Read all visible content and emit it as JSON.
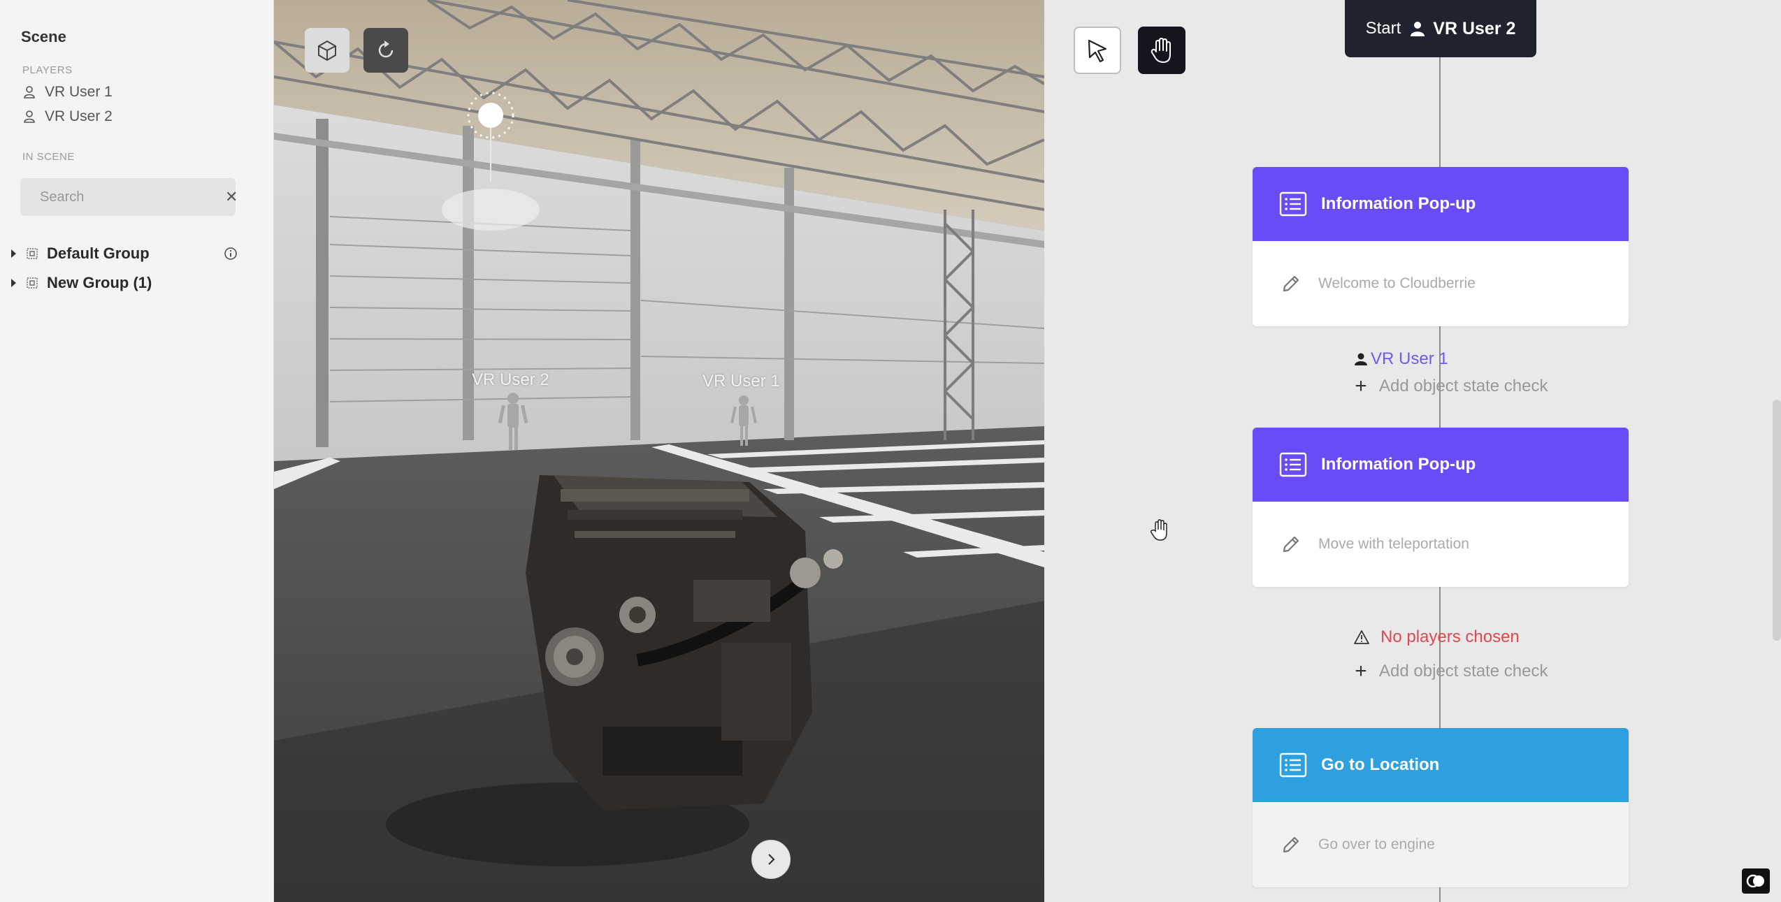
{
  "sidebar": {
    "title": "Scene",
    "players_label": "PLAYERS",
    "players": [
      "VR User 1",
      "VR User 2"
    ],
    "in_scene_label": "IN SCENE",
    "search": {
      "placeholder": "Search",
      "value": ""
    },
    "groups": [
      "Default Group",
      "New Group (1)"
    ]
  },
  "viewport": {
    "avatars": [
      "VR User 2",
      "VR User 1"
    ]
  },
  "flow": {
    "start": {
      "label": "Start",
      "user": "VR User 2"
    },
    "nodes": [
      {
        "title": "Information Pop-up",
        "body": "Welcome to Cloudberrie",
        "color": "#6a4cf6"
      },
      {
        "title": "Information Pop-up",
        "body": "Move with teleportation",
        "color": "#6a4cf6"
      },
      {
        "title": "Go to Location",
        "body": "Go over to engine",
        "color": "#2fa0df"
      }
    ],
    "link1": {
      "user": "VR User 1",
      "add_check": "Add object state check"
    },
    "link2": {
      "warning": "No players chosen",
      "add_check": "Add object state check"
    }
  },
  "colors": {
    "popup_header": "#6a4cf6",
    "location_header": "#2fa0df",
    "player_link": "#6b5cf0",
    "warning": "#e0484e",
    "start_node": "#1f2330"
  }
}
